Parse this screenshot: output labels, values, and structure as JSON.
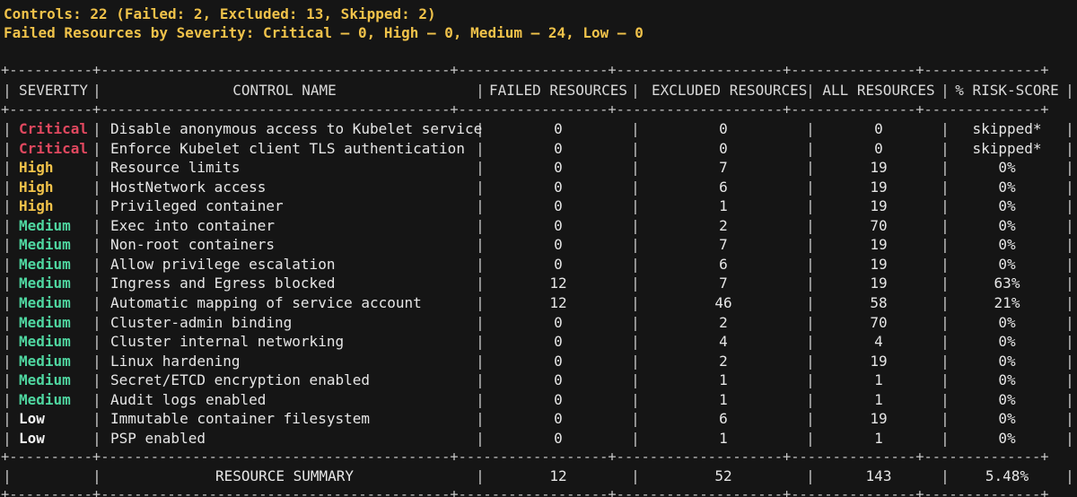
{
  "summary": {
    "controls_line": "Controls: 22 (Failed: 2, Excluded: 13, Skipped: 2)",
    "severity_line": "Failed Resources by Severity: Critical — 0, High — 0, Medium — 24, Low — 0"
  },
  "table": {
    "border_line": "+----------+------------------------------------------+------------------+--------------------+---------------+--------------+",
    "separator_line": "+----------+------------------------------------------+------------------+--------------------+---------------+--------------+",
    "columns": [
      "SEVERITY",
      "CONTROL NAME",
      "FAILED RESOURCES",
      "EXCLUDED RESOURCES",
      "ALL RESOURCES",
      "% RISK-SCORE"
    ],
    "severity_colors": {
      "Critical": "#e0485f",
      "High": "#f0c24a",
      "Medium": "#4fd6a0",
      "Low": "#f2f2f2"
    },
    "rows": [
      {
        "severity": "Critical",
        "control": "Disable anonymous access to Kubelet service",
        "failed": "0",
        "excluded": "0",
        "all": "0",
        "risk": "skipped*"
      },
      {
        "severity": "Critical",
        "control": "Enforce Kubelet client TLS authentication",
        "failed": "0",
        "excluded": "0",
        "all": "0",
        "risk": "skipped*"
      },
      {
        "severity": "High",
        "control": "Resource limits",
        "failed": "0",
        "excluded": "7",
        "all": "19",
        "risk": "0%"
      },
      {
        "severity": "High",
        "control": "HostNetwork access",
        "failed": "0",
        "excluded": "6",
        "all": "19",
        "risk": "0%"
      },
      {
        "severity": "High",
        "control": "Privileged container",
        "failed": "0",
        "excluded": "1",
        "all": "19",
        "risk": "0%"
      },
      {
        "severity": "Medium",
        "control": "Exec into container",
        "failed": "0",
        "excluded": "2",
        "all": "70",
        "risk": "0%"
      },
      {
        "severity": "Medium",
        "control": "Non-root containers",
        "failed": "0",
        "excluded": "7",
        "all": "19",
        "risk": "0%"
      },
      {
        "severity": "Medium",
        "control": "Allow privilege escalation",
        "failed": "0",
        "excluded": "6",
        "all": "19",
        "risk": "0%"
      },
      {
        "severity": "Medium",
        "control": "Ingress and Egress blocked",
        "failed": "12",
        "excluded": "7",
        "all": "19",
        "risk": "63%"
      },
      {
        "severity": "Medium",
        "control": "Automatic mapping of service account",
        "failed": "12",
        "excluded": "46",
        "all": "58",
        "risk": "21%"
      },
      {
        "severity": "Medium",
        "control": "Cluster-admin binding",
        "failed": "0",
        "excluded": "2",
        "all": "70",
        "risk": "0%"
      },
      {
        "severity": "Medium",
        "control": "Cluster internal networking",
        "failed": "0",
        "excluded": "4",
        "all": "4",
        "risk": "0%"
      },
      {
        "severity": "Medium",
        "control": "Linux hardening",
        "failed": "0",
        "excluded": "2",
        "all": "19",
        "risk": "0%"
      },
      {
        "severity": "Medium",
        "control": "Secret/ETCD encryption enabled",
        "failed": "0",
        "excluded": "1",
        "all": "1",
        "risk": "0%"
      },
      {
        "severity": "Medium",
        "control": "Audit logs enabled",
        "failed": "0",
        "excluded": "1",
        "all": "1",
        "risk": "0%"
      },
      {
        "severity": "Low",
        "control": "Immutable container filesystem",
        "failed": "0",
        "excluded": "6",
        "all": "19",
        "risk": "0%"
      },
      {
        "severity": "Low",
        "control": "PSP enabled",
        "failed": "0",
        "excluded": "1",
        "all": "1",
        "risk": "0%"
      }
    ],
    "footer": {
      "label": "RESOURCE SUMMARY",
      "failed": "12",
      "excluded": "52",
      "all": "143",
      "risk": "5.48%"
    }
  }
}
